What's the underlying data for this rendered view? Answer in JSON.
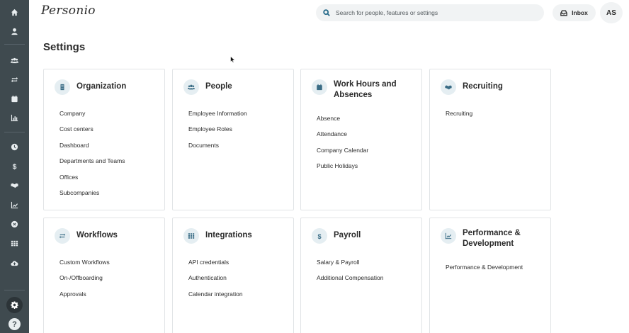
{
  "sidebar": {
    "icons": [
      "home-icon",
      "person-icon",
      "team-icon",
      "workflow-icon",
      "calendar-icon",
      "chart-icon",
      "clock-icon",
      "dollar-icon",
      "handshake-icon",
      "trend-icon",
      "close-circle-icon",
      "grid-icon",
      "cloud-upload-icon"
    ],
    "settings_icon": "gear-icon",
    "help_label": "?"
  },
  "topbar": {
    "logo": "Personio",
    "search_placeholder": "Search for people, features or settings",
    "inbox_label": "Inbox",
    "avatar_initials": "AS"
  },
  "page": {
    "title": "Settings"
  },
  "cards": [
    {
      "title": "Organization",
      "icon": "building-icon",
      "links": [
        "Company",
        "Cost centers",
        "Dashboard",
        "Departments and Teams",
        "Offices",
        "Subcompanies"
      ]
    },
    {
      "title": "People",
      "icon": "people-icon",
      "links": [
        "Employee Information",
        "Employee Roles",
        "Documents"
      ]
    },
    {
      "title": "Work Hours and Absences",
      "icon": "calendar-icon",
      "links": [
        "Absence",
        "Attendance",
        "Company Calendar",
        "Public Holidays"
      ]
    },
    {
      "title": "Recruiting",
      "icon": "handshake-icon",
      "links": [
        "Recruiting"
      ]
    },
    {
      "title": "Workflows",
      "icon": "workflow-icon",
      "links": [
        "Custom Workflows",
        "On-/Offboarding",
        "Approvals"
      ]
    },
    {
      "title": "Integrations",
      "icon": "grid-icon",
      "links": [
        "API credentials",
        "Authentication",
        "Calendar integration"
      ]
    },
    {
      "title": "Payroll",
      "icon": "dollar-icon",
      "links": [
        "Salary & Payroll",
        "Additional Compensation"
      ]
    },
    {
      "title": "Performance & Development",
      "icon": "trend-icon",
      "links": [
        "Performance & Development"
      ]
    }
  ]
}
